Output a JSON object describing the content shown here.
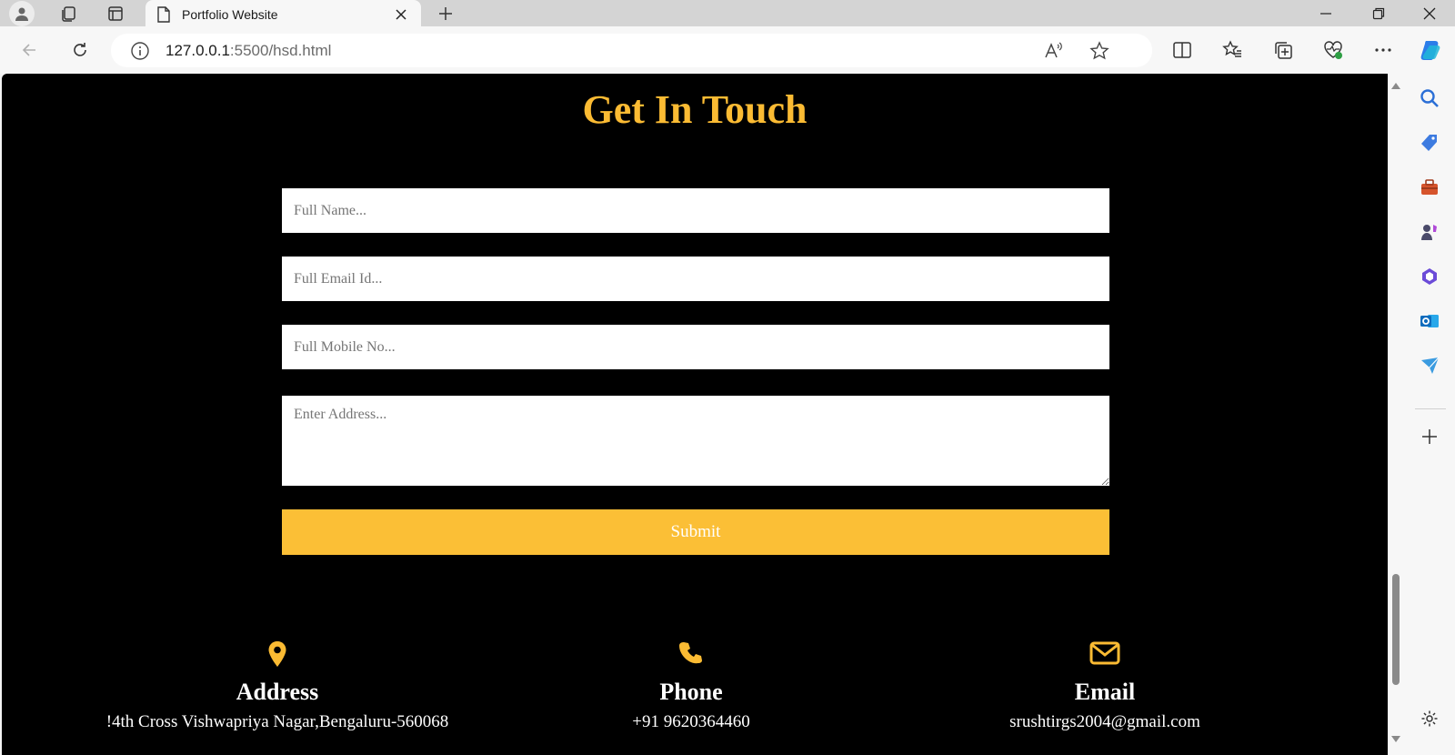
{
  "browser": {
    "tab_title": "Portfolio Website",
    "url_host": "127.0.0.1",
    "url_rest": ":5500/hsd.html"
  },
  "page": {
    "heading": "Get In Touch",
    "form": {
      "name_placeholder": "Full Name...",
      "email_placeholder": "Full Email Id...",
      "mobile_placeholder": "Full Mobile No...",
      "address_placeholder": "Enter Address...",
      "submit_label": "Submit"
    },
    "contact": [
      {
        "icon": "map-pin-icon",
        "label": "Address",
        "value": "!4th Cross Vishwapriya Nagar,Bengaluru-560068"
      },
      {
        "icon": "phone-icon",
        "label": "Phone",
        "value": "+91 9620364460"
      },
      {
        "icon": "envelope-icon",
        "label": "Email",
        "value": "srushtirgs2004@gmail.com"
      }
    ]
  },
  "colors": {
    "accent": "#fbbb33",
    "page_bg": "#000000"
  }
}
